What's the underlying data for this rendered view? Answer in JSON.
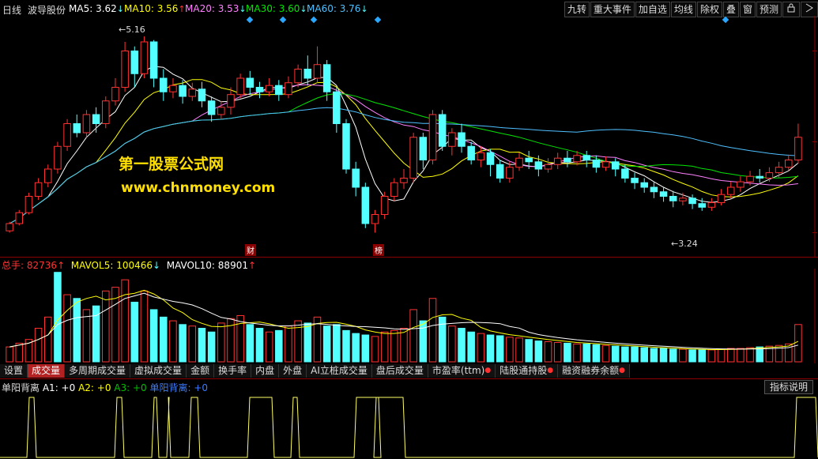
{
  "colors": {
    "up": "#ff3232",
    "down": "#54ffff",
    "ma5": "#ffffff",
    "ma10": "#ffff00",
    "ma20": "#ff80ff",
    "ma30": "#00e600",
    "ma60": "#4ec0ff",
    "brand_yellow": "#ffe000"
  },
  "header": {
    "period": "日线",
    "stock_name": "波导股份",
    "ma5": {
      "label": "MA5:",
      "value": "3.62",
      "arrow": "↓"
    },
    "ma10": {
      "label": "MA10:",
      "value": "3.56",
      "arrow": "↑"
    },
    "ma20": {
      "label": "MA20:",
      "value": "3.53",
      "arrow": "↓"
    },
    "ma30": {
      "label": "MA30:",
      "value": "3.60",
      "arrow": "↓"
    },
    "ma60": {
      "label": "MA60:",
      "value": "3.76",
      "arrow": "↓"
    }
  },
  "toolbar": {
    "buttons": [
      "九转",
      "重大事件",
      "加自选",
      "均线",
      "除权",
      "叠",
      "窗",
      "预测"
    ],
    "icon_lock": "lock-icon",
    "icon_expand": "expand-icon"
  },
  "price_annotations": {
    "high": "5.16",
    "low": "3.24"
  },
  "event_tags": {
    "finance": "财",
    "ranking": "榜"
  },
  "watermark": {
    "line1": "第一股票公式网",
    "line2": "www.chnmoney.com"
  },
  "volume_legend": {
    "total": {
      "label": "总手:",
      "value": "82736",
      "arrow": "↑"
    },
    "mavol5": {
      "label": "MAVOL5:",
      "value": "100466",
      "arrow": "↓"
    },
    "mavol10": {
      "label": "MAVOL10:",
      "value": "88901",
      "arrow": "↑"
    }
  },
  "tabs": [
    {
      "label": "设置",
      "active": false,
      "dot": false
    },
    {
      "label": "成交量",
      "active": true,
      "dot": false
    },
    {
      "label": "多周期成交量",
      "active": false,
      "dot": false
    },
    {
      "label": "虚拟成交量",
      "active": false,
      "dot": false
    },
    {
      "label": "金额",
      "active": false,
      "dot": false
    },
    {
      "label": "换手率",
      "active": false,
      "dot": false
    },
    {
      "label": "内盘",
      "active": false,
      "dot": false
    },
    {
      "label": "外盘",
      "active": false,
      "dot": false
    },
    {
      "label": "AI立桩成交量",
      "active": false,
      "dot": false
    },
    {
      "label": "盘后成交量",
      "active": false,
      "dot": false
    },
    {
      "label": "市盈率(ttm)",
      "active": false,
      "dot": true
    },
    {
      "label": "陆股通持股",
      "active": false,
      "dot": true
    },
    {
      "label": "融资融券余额",
      "active": false,
      "dot": true
    }
  ],
  "indicator_legend": {
    "name": "单阳背离",
    "a1": "A1: +0",
    "a2": "A2: +0",
    "a3": "A3: +0",
    "sig": "单阳背离: +0"
  },
  "indicator_explain": "指标说明",
  "chart_data": {
    "type": "candlestick",
    "high_label": 5.16,
    "low_label": 3.24,
    "candles": [
      [
        3.02,
        3.1,
        3.0,
        3.12
      ],
      [
        3.1,
        3.22,
        3.08,
        3.25
      ],
      [
        3.22,
        3.4,
        3.2,
        3.44
      ],
      [
        3.4,
        3.55,
        3.36,
        3.6
      ],
      [
        3.55,
        3.7,
        3.5,
        3.75
      ],
      [
        3.7,
        3.95,
        3.65,
        4.0
      ],
      [
        3.95,
        4.2,
        3.9,
        4.25
      ],
      [
        4.2,
        4.1,
        4.05,
        4.3
      ],
      [
        4.1,
        4.3,
        4.05,
        4.35
      ],
      [
        4.3,
        4.2,
        4.1,
        4.38
      ],
      [
        4.2,
        4.45,
        4.15,
        4.5
      ],
      [
        4.45,
        4.6,
        4.4,
        4.7
      ],
      [
        4.6,
        5.0,
        4.55,
        5.1
      ],
      [
        5.0,
        4.75,
        4.6,
        5.05
      ],
      [
        4.75,
        5.1,
        4.7,
        5.16
      ],
      [
        5.1,
        4.7,
        4.6,
        5.12
      ],
      [
        4.7,
        4.55,
        4.45,
        4.8
      ],
      [
        4.55,
        4.62,
        4.48,
        4.7
      ],
      [
        4.62,
        4.5,
        4.42,
        4.68
      ],
      [
        4.5,
        4.58,
        4.45,
        4.65
      ],
      [
        4.58,
        4.45,
        4.38,
        4.66
      ],
      [
        4.45,
        4.3,
        4.22,
        4.5
      ],
      [
        4.3,
        4.38,
        4.25,
        4.45
      ],
      [
        4.38,
        4.52,
        4.3,
        4.6
      ],
      [
        4.52,
        4.7,
        4.48,
        4.75
      ],
      [
        4.7,
        4.6,
        4.52,
        4.78
      ],
      [
        4.6,
        4.55,
        4.48,
        4.66
      ],
      [
        4.55,
        4.62,
        4.5,
        4.7
      ],
      [
        4.62,
        4.52,
        4.45,
        4.68
      ],
      [
        4.52,
        4.65,
        4.48,
        4.72
      ],
      [
        4.65,
        4.8,
        4.6,
        4.85
      ],
      [
        4.8,
        4.7,
        4.62,
        4.95
      ],
      [
        4.7,
        4.85,
        4.65,
        5.05
      ],
      [
        4.85,
        4.55,
        4.45,
        4.9
      ],
      [
        4.55,
        4.2,
        4.1,
        4.6
      ],
      [
        4.2,
        3.7,
        3.65,
        4.25
      ],
      [
        3.7,
        3.5,
        3.4,
        3.78
      ],
      [
        3.5,
        3.1,
        3.05,
        3.55
      ],
      [
        3.1,
        3.2,
        3.0,
        3.25
      ],
      [
        3.2,
        3.4,
        3.15,
        3.45
      ],
      [
        3.4,
        3.55,
        3.35,
        3.6
      ],
      [
        3.55,
        3.6,
        3.48,
        3.7
      ],
      [
        3.6,
        4.05,
        3.55,
        4.1
      ],
      [
        4.05,
        3.8,
        3.7,
        4.1
      ],
      [
        3.8,
        4.3,
        3.75,
        4.35
      ],
      [
        4.3,
        3.95,
        3.9,
        4.35
      ],
      [
        3.95,
        4.1,
        3.85,
        4.15
      ],
      [
        4.1,
        3.95,
        3.88,
        4.2
      ],
      [
        3.95,
        3.8,
        3.75,
        4.0
      ],
      [
        3.8,
        3.88,
        3.72,
        3.95
      ],
      [
        3.88,
        3.75,
        3.62,
        3.92
      ],
      [
        3.75,
        3.6,
        3.55,
        3.8
      ],
      [
        3.6,
        3.72,
        3.55,
        3.78
      ],
      [
        3.72,
        3.82,
        3.68,
        3.88
      ],
      [
        3.82,
        3.78,
        3.7,
        3.9
      ],
      [
        3.78,
        3.7,
        3.62,
        3.85
      ],
      [
        3.7,
        3.75,
        3.66,
        3.82
      ],
      [
        3.75,
        3.82,
        3.7,
        3.88
      ],
      [
        3.82,
        3.78,
        3.72,
        3.9
      ],
      [
        3.78,
        3.85,
        3.74,
        3.9
      ],
      [
        3.85,
        3.8,
        3.72,
        3.9
      ],
      [
        3.8,
        3.72,
        3.66,
        3.85
      ],
      [
        3.72,
        3.78,
        3.68,
        3.84
      ],
      [
        3.78,
        3.7,
        3.62,
        3.82
      ],
      [
        3.7,
        3.6,
        3.55,
        3.75
      ],
      [
        3.6,
        3.55,
        3.48,
        3.66
      ],
      [
        3.55,
        3.5,
        3.44,
        3.6
      ],
      [
        3.5,
        3.45,
        3.38,
        3.56
      ],
      [
        3.45,
        3.4,
        3.34,
        3.5
      ],
      [
        3.4,
        3.35,
        3.28,
        3.46
      ],
      [
        3.35,
        3.38,
        3.3,
        3.44
      ],
      [
        3.38,
        3.32,
        3.26,
        3.42
      ],
      [
        3.32,
        3.28,
        3.24,
        3.38
      ],
      [
        3.28,
        3.33,
        3.24,
        3.38
      ],
      [
        3.33,
        3.42,
        3.3,
        3.48
      ],
      [
        3.42,
        3.5,
        3.38,
        3.56
      ],
      [
        3.5,
        3.56,
        3.45,
        3.62
      ],
      [
        3.56,
        3.62,
        3.52,
        3.68
      ],
      [
        3.62,
        3.6,
        3.55,
        3.7
      ],
      [
        3.6,
        3.66,
        3.56,
        3.72
      ],
      [
        3.66,
        3.72,
        3.6,
        3.78
      ],
      [
        3.72,
        3.8,
        3.68,
        3.86
      ],
      [
        3.8,
        4.05,
        3.76,
        4.2
      ]
    ],
    "volumes": [
      20,
      25,
      30,
      45,
      60,
      120,
      90,
      85,
      70,
      75,
      95,
      100,
      110,
      80,
      95,
      70,
      60,
      55,
      50,
      48,
      45,
      40,
      52,
      58,
      62,
      50,
      45,
      40,
      42,
      48,
      55,
      52,
      60,
      48,
      50,
      42,
      38,
      36,
      34,
      40,
      42,
      45,
      70,
      55,
      85,
      60,
      48,
      45,
      40,
      38,
      36,
      35,
      33,
      32,
      30,
      28,
      27,
      26,
      25,
      24,
      24,
      23,
      22,
      21,
      20,
      20,
      19,
      18,
      18,
      17,
      17,
      16,
      16,
      16,
      17,
      18,
      18,
      19,
      20,
      21,
      22,
      24,
      50
    ],
    "volume_colors_up": [
      1,
      1,
      1,
      1,
      1,
      0,
      1,
      0,
      1,
      0,
      1,
      1,
      1,
      0,
      1,
      0,
      0,
      1,
      0,
      1,
      0,
      0,
      1,
      1,
      1,
      0,
      0,
      1,
      0,
      1,
      1,
      0,
      1,
      0,
      0,
      0,
      0,
      0,
      1,
      1,
      1,
      1,
      1,
      0,
      1,
      0,
      1,
      0,
      0,
      1,
      0,
      0,
      1,
      1,
      0,
      0,
      1,
      1,
      0,
      1,
      0,
      0,
      1,
      0,
      0,
      0,
      0,
      0,
      0,
      0,
      1,
      0,
      0,
      1,
      1,
      1,
      1,
      1,
      0,
      1,
      1,
      1,
      1
    ],
    "indicator_pulses": [
      [
        34,
        46
      ],
      [
        145,
        157
      ],
      [
        192,
        201
      ],
      [
        211,
        216
      ],
      [
        239,
        253
      ],
      [
        313,
        347
      ],
      [
        368,
        379
      ],
      [
        448,
        482
      ],
      [
        473,
        513
      ],
      [
        1005,
        1035
      ]
    ]
  }
}
